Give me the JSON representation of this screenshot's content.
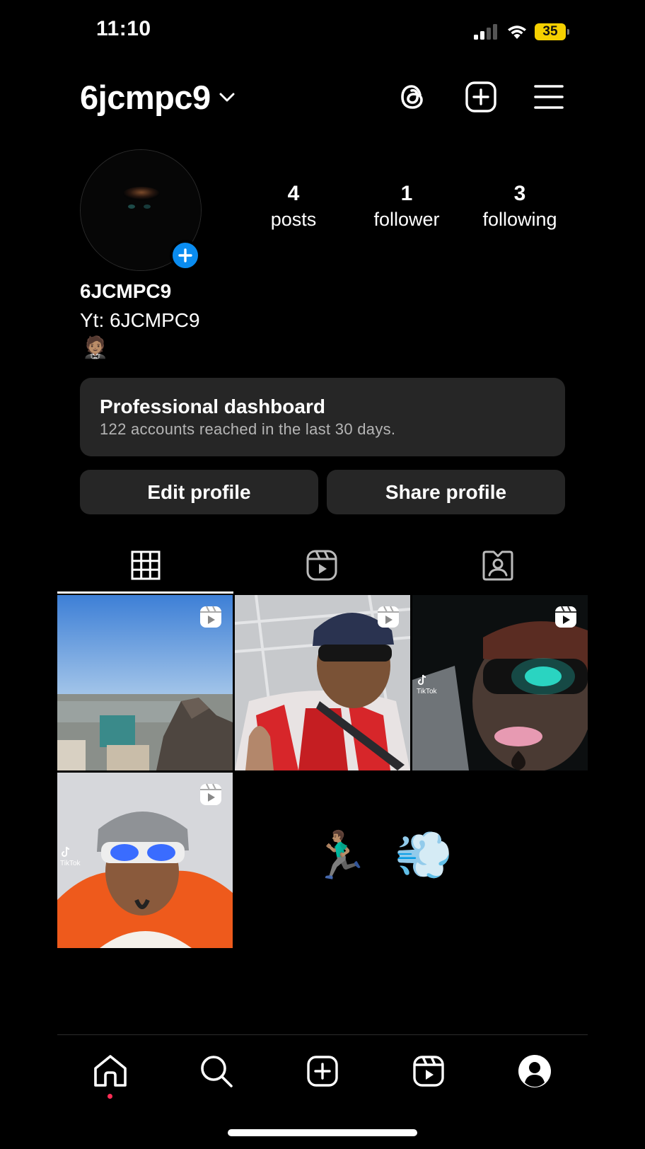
{
  "status_bar": {
    "time": "11:10",
    "battery": "35"
  },
  "header": {
    "username": "6jcmpc9",
    "icons": [
      "threads-icon",
      "create-post-icon",
      "menu-icon"
    ]
  },
  "profile": {
    "stats": [
      {
        "value": "4",
        "label": "posts"
      },
      {
        "value": "1",
        "label": "follower"
      },
      {
        "value": "3",
        "label": "following"
      }
    ],
    "display_name": "6JCMPC9",
    "bio_line": "Yt: 6JCMPC9",
    "bio_emoji": "🤵🏽"
  },
  "dashboard": {
    "title": "Professional dashboard",
    "subtitle": "122 accounts reached in the last 30 days."
  },
  "buttons": {
    "edit": "Edit profile",
    "share": "Share profile"
  },
  "tabs": [
    "posts-grid-icon",
    "reels-tab-icon",
    "tagged-tab-icon"
  ],
  "grid": {
    "posts": [
      {
        "kind": "reel",
        "scene": "city skyline from rock"
      },
      {
        "kind": "reel",
        "scene": "selfie with sunglasses, red white jersey"
      },
      {
        "kind": "reel",
        "scene": "dark selfie with glowing glasses",
        "watermark": "TikTok"
      },
      {
        "kind": "reel",
        "scene": "selfie with white sunglasses, orange bandana",
        "watermark": "TikTok"
      }
    ],
    "emoji_text": "🏃🏽‍♂️💨"
  },
  "nav": [
    "home-icon",
    "search-icon",
    "create-icon",
    "reels-icon",
    "profile-icon"
  ],
  "colors": {
    "accent": "#0a8cf0",
    "surface": "#262626",
    "notification": "#ff2d55"
  }
}
